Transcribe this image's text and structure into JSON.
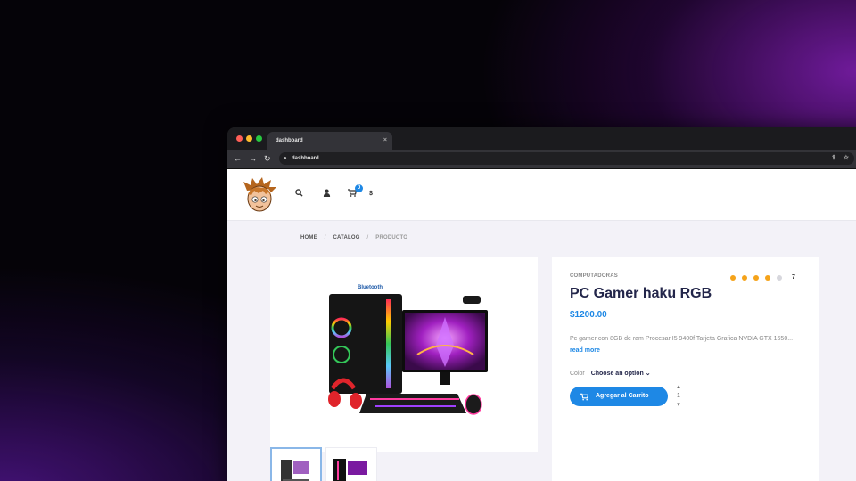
{
  "browser": {
    "tab_title": "dashboard",
    "tab_close": "×",
    "url": "dashboard",
    "icons": {
      "back": "←",
      "forward": "→",
      "reload": "↻",
      "lock": "🔒",
      "share": "⇪",
      "star": "☆"
    }
  },
  "header": {
    "icons": {
      "search": "⌕",
      "user": "👤",
      "cart": "🛒"
    },
    "cart_count": "0",
    "cart_total": "$"
  },
  "breadcrumb": {
    "items": [
      "HOME",
      "CATALOG",
      "PRODUCTO"
    ],
    "separator": "/"
  },
  "product": {
    "category": "COMPUTADORAS",
    "rating": 4,
    "rating_max": 5,
    "rating_count": "7",
    "title": "PC Gamer haku RGB",
    "price": "$1200.00",
    "description": "Pc gamer con 8GB de ram Procesar I5 9400f Tarjeta Grafica NVDIA GTX 1650...",
    "read_more": "read more",
    "color_label": "Color",
    "color_value": "Choose an option",
    "color_caret": "⌄",
    "add_to_cart": "Agregar al Carrito",
    "add_to_cart_icon": "🛒",
    "quantity": "1",
    "qty_up": "▴",
    "qty_down": "▾",
    "image_brand_text": "Bluetooth"
  },
  "colors": {
    "accent": "#1e88e5",
    "rating": "#f5a31a",
    "title": "#23264a"
  }
}
